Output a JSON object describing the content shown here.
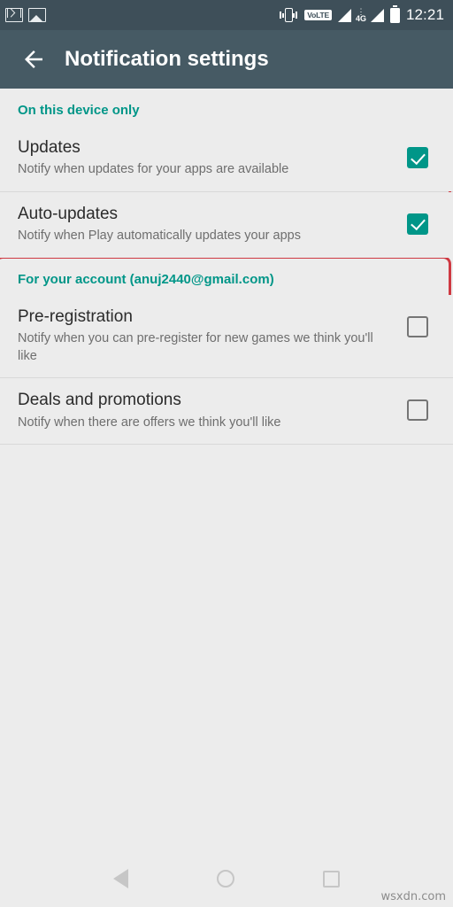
{
  "status_bar": {
    "left_icons": [
      "gmail-icon",
      "photos-icon"
    ],
    "right_icons": [
      "vibrate-icon",
      "volte-icon",
      "signal-icon",
      "signal-icon",
      "battery-icon"
    ],
    "volte_label": "VoLTE",
    "network_label": "4G",
    "network_dots": "⋮",
    "time": "12:21"
  },
  "app_bar": {
    "back_icon": "back-arrow-icon",
    "title": "Notification settings"
  },
  "sections": [
    {
      "header": "On this device only",
      "rows": [
        {
          "title": "Updates",
          "subtitle": "Notify when updates for your apps are available",
          "checked": true,
          "highlighted": true
        },
        {
          "title": "Auto-updates",
          "subtitle": "Notify when Play automatically updates your apps",
          "checked": true,
          "highlighted": true
        }
      ]
    },
    {
      "header": "For your account (anuj2440@gmail.com)",
      "rows": [
        {
          "title": "Pre-registration",
          "subtitle": "Notify when you can pre-register for new games we think you'll like",
          "checked": false,
          "highlighted": false
        },
        {
          "title": "Deals and promotions",
          "subtitle": "Notify when there are offers we think you'll like",
          "checked": false,
          "highlighted": false
        }
      ]
    }
  ],
  "nav_bar": {
    "back": "nav-back-icon",
    "home": "nav-home-icon",
    "recents": "nav-recents-icon"
  },
  "watermark": "wsxdn.com",
  "colors": {
    "status_bar_bg": "#3e4f59",
    "app_bar_bg": "#465a64",
    "accent_teal": "#009688",
    "highlight_red": "#cf3942",
    "page_bg": "#ececec"
  }
}
